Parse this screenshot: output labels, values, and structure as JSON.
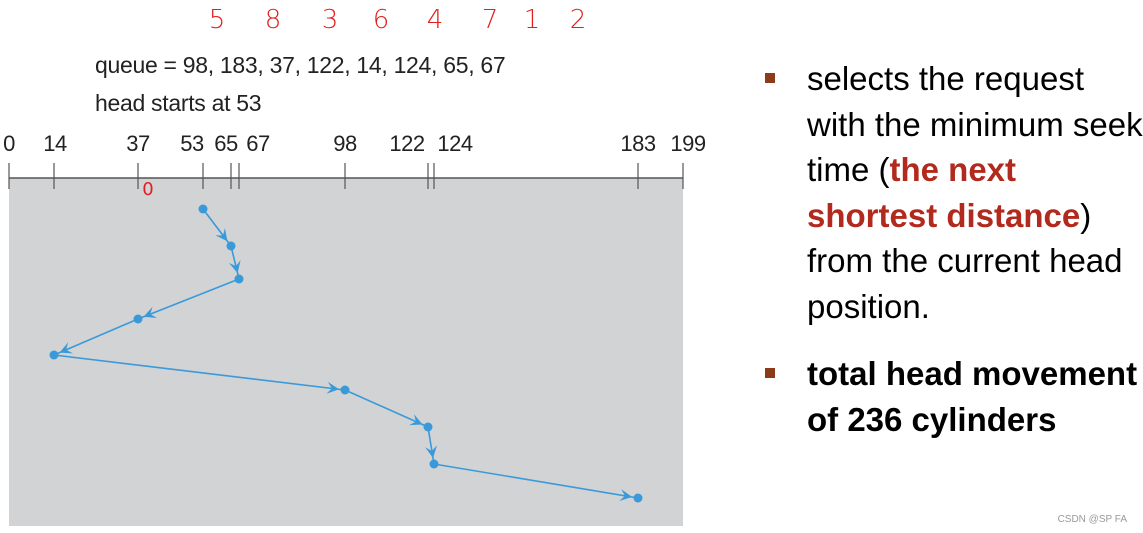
{
  "diagram": {
    "queue_label": "queue = 98, 183, 37, 122, 14, 124, 65, 67",
    "head_label": "head starts at 53",
    "queue": [
      98,
      183,
      37,
      122,
      14,
      124,
      65,
      67
    ],
    "service_order_annotations": [
      "5",
      "8",
      "3",
      "6",
      "4",
      "7",
      "1",
      "2"
    ],
    "start_annotation": "0",
    "axis_ticks": [
      0,
      14,
      37,
      53,
      65,
      67,
      98,
      122,
      124,
      183,
      199
    ],
    "tick_labels": [
      "0",
      "14",
      "37",
      "53",
      "65",
      "67",
      "98",
      "122",
      "124",
      "183",
      "199"
    ],
    "head_path": [
      53,
      65,
      67,
      37,
      14,
      98,
      122,
      124,
      183
    ],
    "colors": {
      "path": "#3a9ad9",
      "annotation": "#e02020",
      "panel": "#d1d3d4"
    }
  },
  "bullets": [
    {
      "pre": "selects the request with the minimum seek time (",
      "highlight": "the next shortest distance",
      "post": ") from the current head position."
    },
    {
      "text": "total head movement of 236 cylinders"
    }
  ],
  "watermark": "CSDN @SP FA"
}
